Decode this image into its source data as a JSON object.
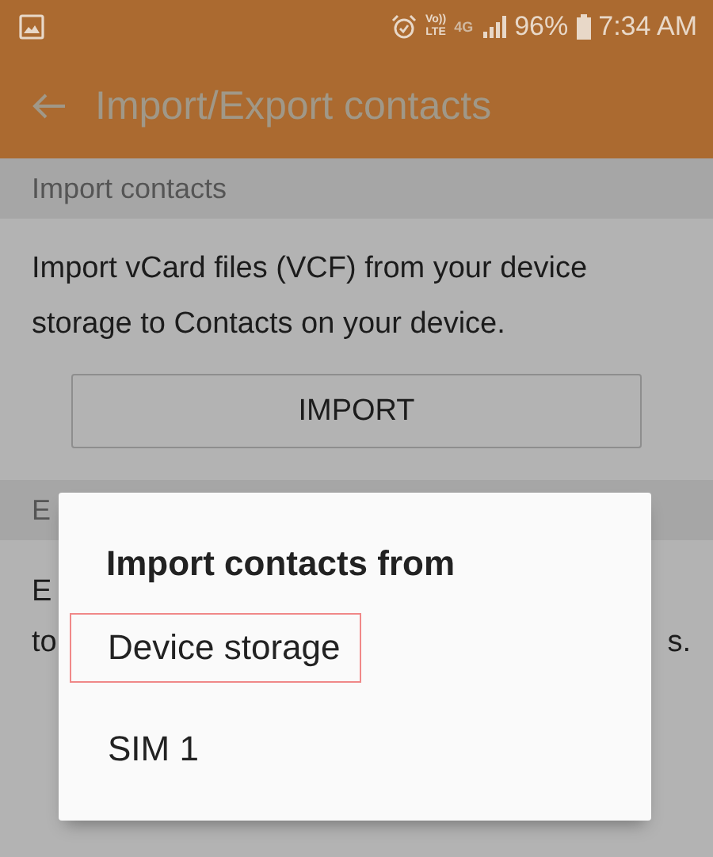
{
  "status_bar": {
    "battery": "96%",
    "time": "7:34 AM",
    "network": "4G",
    "volte": "Vo))\nLTE"
  },
  "toolbar": {
    "title": "Import/Export contacts"
  },
  "import_section": {
    "header": "Import contacts",
    "description": "Import vCard files (VCF) from your device storage to Contacts on your device.",
    "button": "IMPORT"
  },
  "export_section": {
    "header": "E",
    "line_1": "E",
    "line_2_start": "to",
    "line_2_end": "s."
  },
  "dialog": {
    "title": "Import contacts from",
    "options": [
      {
        "label": "Device storage",
        "highlighted": true
      },
      {
        "label": "SIM 1",
        "highlighted": false
      }
    ]
  }
}
